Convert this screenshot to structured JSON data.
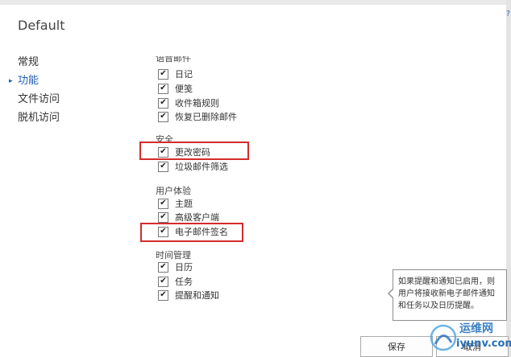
{
  "window": {
    "title": "Default",
    "corner_glyph": "?"
  },
  "nav": {
    "items": [
      {
        "label": "常规",
        "selected": false
      },
      {
        "label": "功能",
        "selected": true
      },
      {
        "label": "文件访问",
        "selected": false
      },
      {
        "label": "脱机访问",
        "selected": false
      }
    ],
    "selected_marker": "▸"
  },
  "features": {
    "clipped_heading": "语音邮件",
    "sections": [
      {
        "items": [
          {
            "label": "日记",
            "checked": true
          },
          {
            "label": "便笺",
            "checked": true
          },
          {
            "label": "收件箱规则",
            "checked": true
          },
          {
            "label": "恢复已删除邮件",
            "checked": true
          }
        ]
      },
      {
        "title": "安全",
        "items": [
          {
            "label": "更改密码",
            "checked": true,
            "highlighted": true
          },
          {
            "label": "垃圾邮件筛选",
            "checked": true
          }
        ]
      },
      {
        "title": "用户体验",
        "items": [
          {
            "label": "主题",
            "checked": true
          },
          {
            "label": "高级客户端",
            "checked": true
          },
          {
            "label": "电子邮件签名",
            "checked": true,
            "highlighted": true
          }
        ]
      },
      {
        "title": "时间管理",
        "items": [
          {
            "label": "日历",
            "checked": true
          },
          {
            "label": "任务",
            "checked": true
          },
          {
            "label": "提醒和通知",
            "checked": true
          }
        ]
      }
    ]
  },
  "tooltip": {
    "text": "如果提醒和通知已启用，则用户将接收新电子邮件通知和任务以及日历提醒。"
  },
  "buttons": {
    "save": "保存",
    "cancel": "取消"
  },
  "colors": {
    "highlight": "#d42b2b",
    "selected_nav": "#1f5fb4"
  },
  "icons": {
    "check": "check-icon",
    "arrow": "selected-arrow-icon"
  },
  "watermark": {
    "name": "运维网",
    "domain": "iyunv.com"
  }
}
